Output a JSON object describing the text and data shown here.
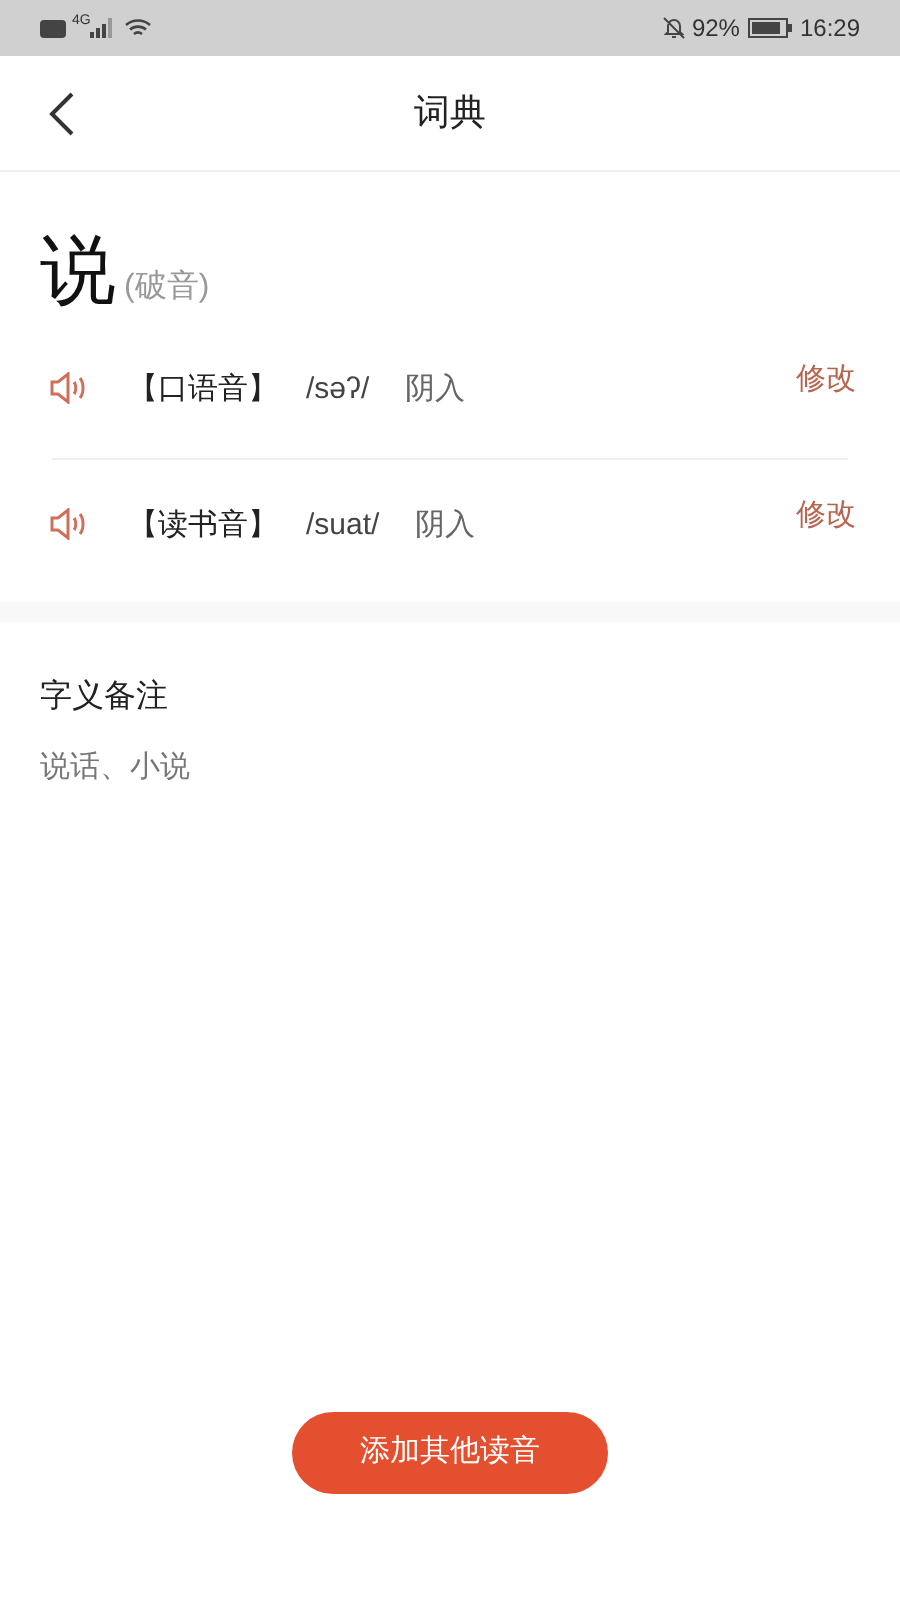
{
  "status_bar": {
    "network": "4G",
    "battery": "92%",
    "time": "16:29"
  },
  "header": {
    "title": "词典"
  },
  "entry": {
    "character": "说",
    "note": "(破音)",
    "readings": [
      {
        "label": "【口语音】",
        "ipa": "/səʔ/",
        "tone": "阴入",
        "action": "修改"
      },
      {
        "label": "【读书音】",
        "ipa": "/suat/",
        "tone": "阴入",
        "action": "修改"
      }
    ]
  },
  "meaning": {
    "title": "字义备注",
    "text": "说话、小说"
  },
  "button": "添加其他读音"
}
